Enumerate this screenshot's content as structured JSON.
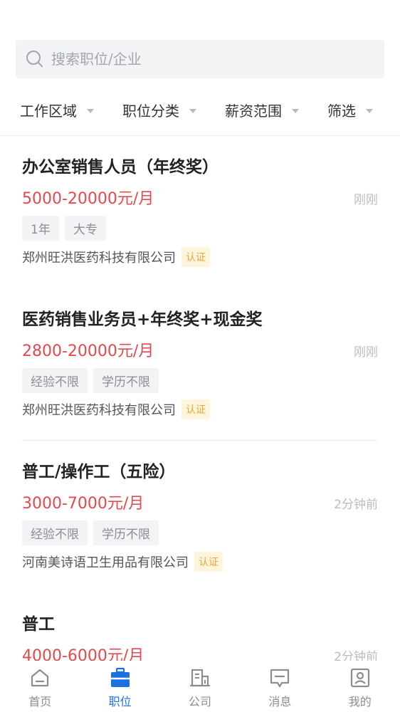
{
  "search": {
    "placeholder": "搜索职位/企业"
  },
  "filters": [
    {
      "label": "工作区域"
    },
    {
      "label": "职位分类"
    },
    {
      "label": "薪资范围"
    },
    {
      "label": "筛选"
    }
  ],
  "jobs": [
    {
      "title": "办公室销售人员（年终奖）",
      "salary": "5000-20000元/月",
      "time": "刚刚",
      "tags": [
        "1年",
        "大专"
      ],
      "company": "郑州旺洪医药科技有限公司",
      "badge": "认证"
    },
    {
      "title": "医药销售业务员+年终奖+现金奖",
      "salary": "2800-20000元/月",
      "time": "刚刚",
      "tags": [
        "经验不限",
        "学历不限"
      ],
      "company": "郑州旺洪医药科技有限公司",
      "badge": "认证"
    },
    {
      "title": "普工/操作工（五险）",
      "salary": "3000-7000元/月",
      "time": "2分钟前",
      "tags": [
        "经验不限",
        "学历不限"
      ],
      "company": "河南美诗语卫生用品有限公司",
      "badge": "认证"
    },
    {
      "title": "普工",
      "salary": "4000-6000元/月",
      "time": "2分钟前",
      "tags": [],
      "company": "",
      "badge": ""
    }
  ],
  "tabbar": {
    "active": "职位",
    "active_color": "#1e6fe0",
    "items": [
      {
        "label": "首页",
        "icon": "home-icon"
      },
      {
        "label": "职位",
        "icon": "briefcase-icon"
      },
      {
        "label": "公司",
        "icon": "building-icon"
      },
      {
        "label": "消息",
        "icon": "message-icon"
      },
      {
        "label": "我的",
        "icon": "profile-icon"
      }
    ]
  },
  "colors": {
    "salary": "#e5484d",
    "badge_bg": "#fff4dc",
    "badge_text": "#e8a93a",
    "accent": "#1e6fe0"
  }
}
